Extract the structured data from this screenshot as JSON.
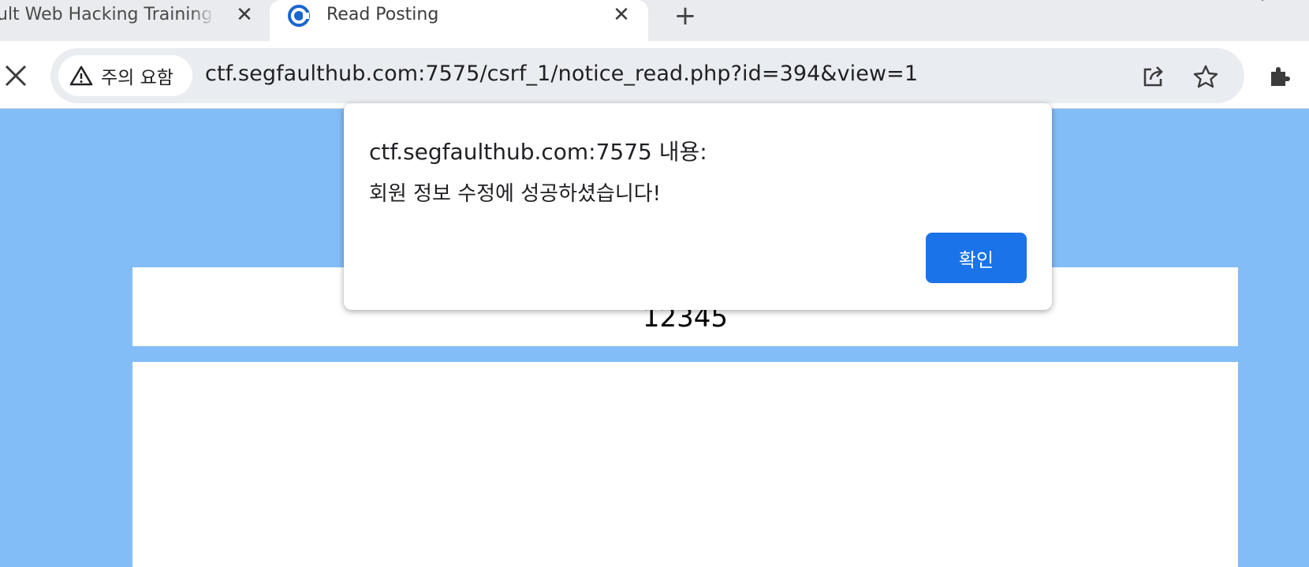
{
  "tabs": [
    {
      "title": "ult Web Hacking Training",
      "close_icon": "close-icon"
    },
    {
      "title": "Read Posting",
      "close_icon": "close-icon",
      "favicon": "segfault-logo-icon"
    }
  ],
  "new_tab_icon": "plus-icon",
  "toolbar": {
    "stop_icon": "close-icon",
    "security_chip": "주의 요함",
    "url": "ctf.segfaulthub.com:7575/csrf_1/notice_read.php?id=394&view=1",
    "icons": [
      "share-icon",
      "star-icon",
      "puzzle-icon"
    ]
  },
  "page": {
    "post_title": "12345",
    "background_color": "#83bdf7"
  },
  "dialog": {
    "origin": "ctf.segfaulthub.com:7575 내용:",
    "message": "회원 정보 수정에 성공하셨습니다!",
    "ok_label": "확인",
    "button_color": "#1a73e8"
  }
}
